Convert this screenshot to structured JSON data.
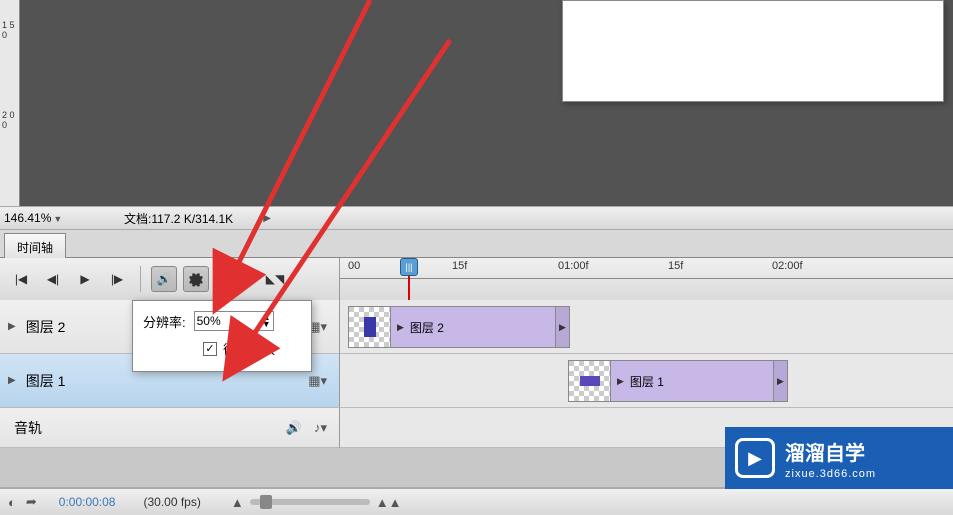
{
  "ruler": {
    "tick1": "1\n5\n0",
    "tick2": "2\n0\n0"
  },
  "status": {
    "zoom": "146.41%",
    "doc_label": "文档:",
    "doc_value": "117.2 K/314.1K"
  },
  "tabs": {
    "timeline": "时间轴"
  },
  "time_ticks": {
    "t0": "00",
    "t1": "15f",
    "t2": "01:00f",
    "t3": "15f",
    "t4": "02:00f"
  },
  "settings": {
    "resolution_label": "分辨率:",
    "resolution_value": "50%",
    "loop_label": "循环播放",
    "loop_checked": true
  },
  "layers": {
    "layer2": "图层 2",
    "layer1": "图层 1"
  },
  "clips": {
    "clip2": "图层 2",
    "clip1": "图层 1"
  },
  "audio": {
    "label": "音轨"
  },
  "bottom": {
    "timecode": "0:00:00:08",
    "fps": "(30.00 fps)"
  },
  "watermark": {
    "title": "溜溜自学",
    "url": "zixue.3d66.com"
  },
  "colors": {
    "clip_thumb2": "#3a38a8",
    "clip_thumb1": "#5a48b8"
  }
}
